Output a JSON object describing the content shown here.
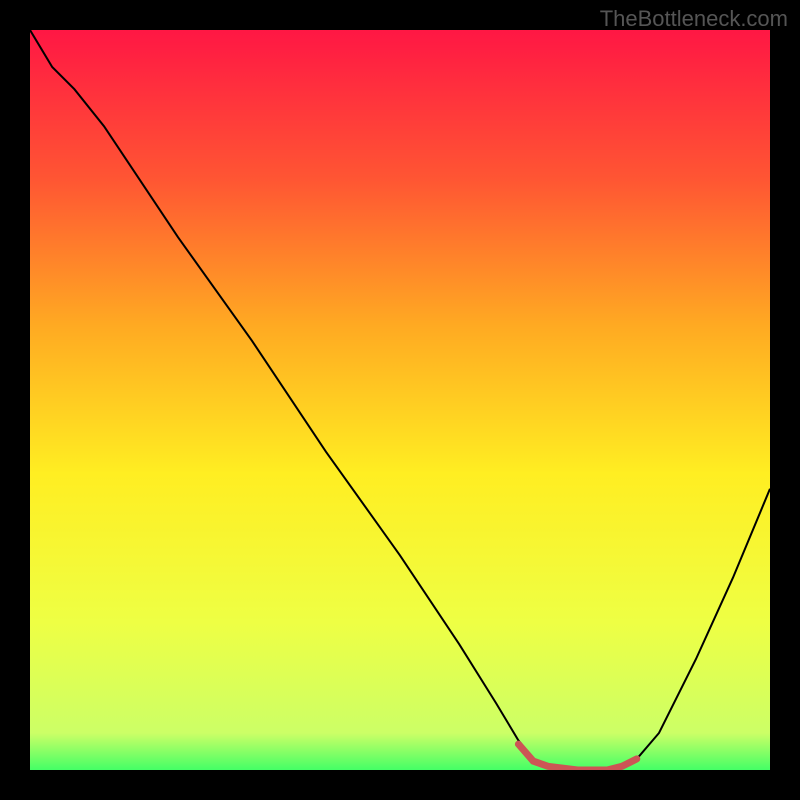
{
  "watermark": "TheBottleneck.com",
  "chart_data": {
    "type": "line",
    "title": "",
    "xlabel": "",
    "ylabel": "",
    "xlim": [
      0,
      100
    ],
    "ylim": [
      0,
      100
    ],
    "gradient_stops": [
      {
        "offset": 0,
        "color": "#ff1744"
      },
      {
        "offset": 20,
        "color": "#ff5533"
      },
      {
        "offset": 40,
        "color": "#ffaa22"
      },
      {
        "offset": 60,
        "color": "#ffee22"
      },
      {
        "offset": 80,
        "color": "#eeff44"
      },
      {
        "offset": 95,
        "color": "#ccff66"
      },
      {
        "offset": 100,
        "color": "#44ff66"
      }
    ],
    "series": [
      {
        "name": "bottleneck-curve",
        "color": "#000000",
        "stroke_width": 2,
        "points": [
          {
            "x": 0,
            "y": 100
          },
          {
            "x": 3,
            "y": 95
          },
          {
            "x": 6,
            "y": 92
          },
          {
            "x": 10,
            "y": 87
          },
          {
            "x": 20,
            "y": 72
          },
          {
            "x": 30,
            "y": 58
          },
          {
            "x": 40,
            "y": 43
          },
          {
            "x": 50,
            "y": 29
          },
          {
            "x": 58,
            "y": 17
          },
          {
            "x": 63,
            "y": 9
          },
          {
            "x": 66,
            "y": 4
          },
          {
            "x": 68,
            "y": 1.5
          },
          {
            "x": 70,
            "y": 0.5
          },
          {
            "x": 74,
            "y": 0
          },
          {
            "x": 78,
            "y": 0
          },
          {
            "x": 80,
            "y": 0.5
          },
          {
            "x": 82,
            "y": 1.5
          },
          {
            "x": 85,
            "y": 5
          },
          {
            "x": 90,
            "y": 15
          },
          {
            "x": 95,
            "y": 26
          },
          {
            "x": 100,
            "y": 38
          }
        ]
      },
      {
        "name": "optimal-range-marker",
        "color": "#cc5555",
        "stroke_width": 7,
        "stroke_linecap": "round",
        "points": [
          {
            "x": 66,
            "y": 3.5
          },
          {
            "x": 68,
            "y": 1.2
          },
          {
            "x": 70,
            "y": 0.5
          },
          {
            "x": 74,
            "y": 0
          },
          {
            "x": 78,
            "y": 0
          },
          {
            "x": 80,
            "y": 0.5
          },
          {
            "x": 82,
            "y": 1.5
          }
        ]
      }
    ]
  }
}
